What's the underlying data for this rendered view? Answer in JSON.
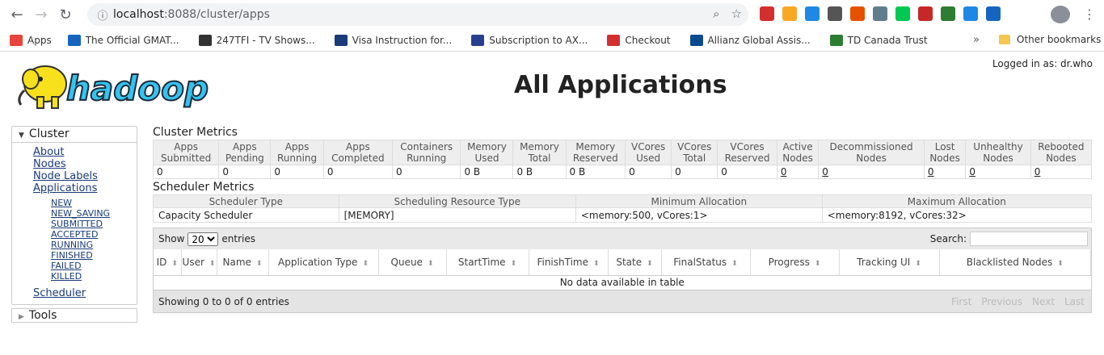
{
  "browser": {
    "url_host": "localhost",
    "url_rest": ":8088/cluster/apps",
    "bookmarks": [
      {
        "label": "Apps",
        "color": "#e8453c"
      },
      {
        "label": "The Official GMAT...",
        "color": "#1565c0"
      },
      {
        "label": "247TFI - TV Shows...",
        "color": "#333333"
      },
      {
        "label": "Visa Instruction for...",
        "color": "#1a3a7a"
      },
      {
        "label": "Subscription to AX...",
        "color": "#2a3f8f"
      },
      {
        "label": "Checkout",
        "color": "#d32f2f"
      },
      {
        "label": "Allianz Global Assis...",
        "color": "#0b4a8f"
      },
      {
        "label": "TD Canada Trust",
        "color": "#2e7d32"
      }
    ],
    "other_bookmarks": "Other bookmarks",
    "extension_colors": [
      "#d32f2f",
      "#f9a825",
      "#1e88e5",
      "#555555",
      "#e65100",
      "#607d8b",
      "#00c853",
      "#c62828",
      "#2e7d32",
      "#1e88e5",
      "#1565c0"
    ]
  },
  "page": {
    "logged_in": "Logged in as: dr.who",
    "title": "All Applications",
    "logo_text": "hadoop"
  },
  "sidebar": {
    "cluster_label": "Cluster",
    "links": [
      "About",
      "Nodes",
      "Node Labels",
      "Applications"
    ],
    "states": [
      "NEW",
      "NEW_SAVING",
      "SUBMITTED",
      "ACCEPTED",
      "RUNNING",
      "FINISHED",
      "FAILED",
      "KILLED"
    ],
    "scheduler": "Scheduler",
    "tools_label": "Tools"
  },
  "cluster_metrics": {
    "title": "Cluster Metrics",
    "headers": [
      [
        "Apps",
        "Submitted"
      ],
      [
        "Apps",
        "Pending"
      ],
      [
        "Apps",
        "Running"
      ],
      [
        "Apps",
        "Completed"
      ],
      [
        "Containers",
        "Running"
      ],
      [
        "Memory",
        "Used"
      ],
      [
        "Memory",
        "Total"
      ],
      [
        "Memory",
        "Reserved"
      ],
      [
        "VCores",
        "Used"
      ],
      [
        "VCores",
        "Total"
      ],
      [
        "VCores",
        "Reserved"
      ],
      [
        "Active",
        "Nodes"
      ],
      [
        "Decommissioned",
        "Nodes"
      ],
      [
        "Lost",
        "Nodes"
      ],
      [
        "Unhealthy",
        "Nodes"
      ],
      [
        "Rebooted",
        "Nodes"
      ]
    ],
    "values": [
      "0",
      "0",
      "0",
      "0",
      "0",
      "0 B",
      "0 B",
      "0 B",
      "0",
      "0",
      "0",
      "0",
      "0",
      "0",
      "0",
      "0"
    ],
    "linked": [
      false,
      false,
      false,
      false,
      false,
      false,
      false,
      false,
      false,
      false,
      false,
      true,
      true,
      true,
      true,
      true
    ]
  },
  "scheduler_metrics": {
    "title": "Scheduler Metrics",
    "headers": [
      "Scheduler Type",
      "Scheduling Resource Type",
      "Minimum Allocation",
      "Maximum Allocation"
    ],
    "values": [
      "Capacity Scheduler",
      "[MEMORY]",
      "<memory:500, vCores:1>",
      "<memory:8192, vCores:32>"
    ]
  },
  "apps_table": {
    "show_label": "Show",
    "entries_label": "entries",
    "page_size": "20",
    "search_label": "Search:",
    "columns": [
      "ID",
      "User",
      "Name",
      "Application Type",
      "Queue",
      "StartTime",
      "FinishTime",
      "State",
      "FinalStatus",
      "Progress",
      "Tracking UI",
      "Blacklisted Nodes"
    ],
    "empty": "No data available in table",
    "info": "Showing 0 to 0 of 0 entries",
    "pager": [
      "First",
      "Previous",
      "Next",
      "Last"
    ]
  }
}
